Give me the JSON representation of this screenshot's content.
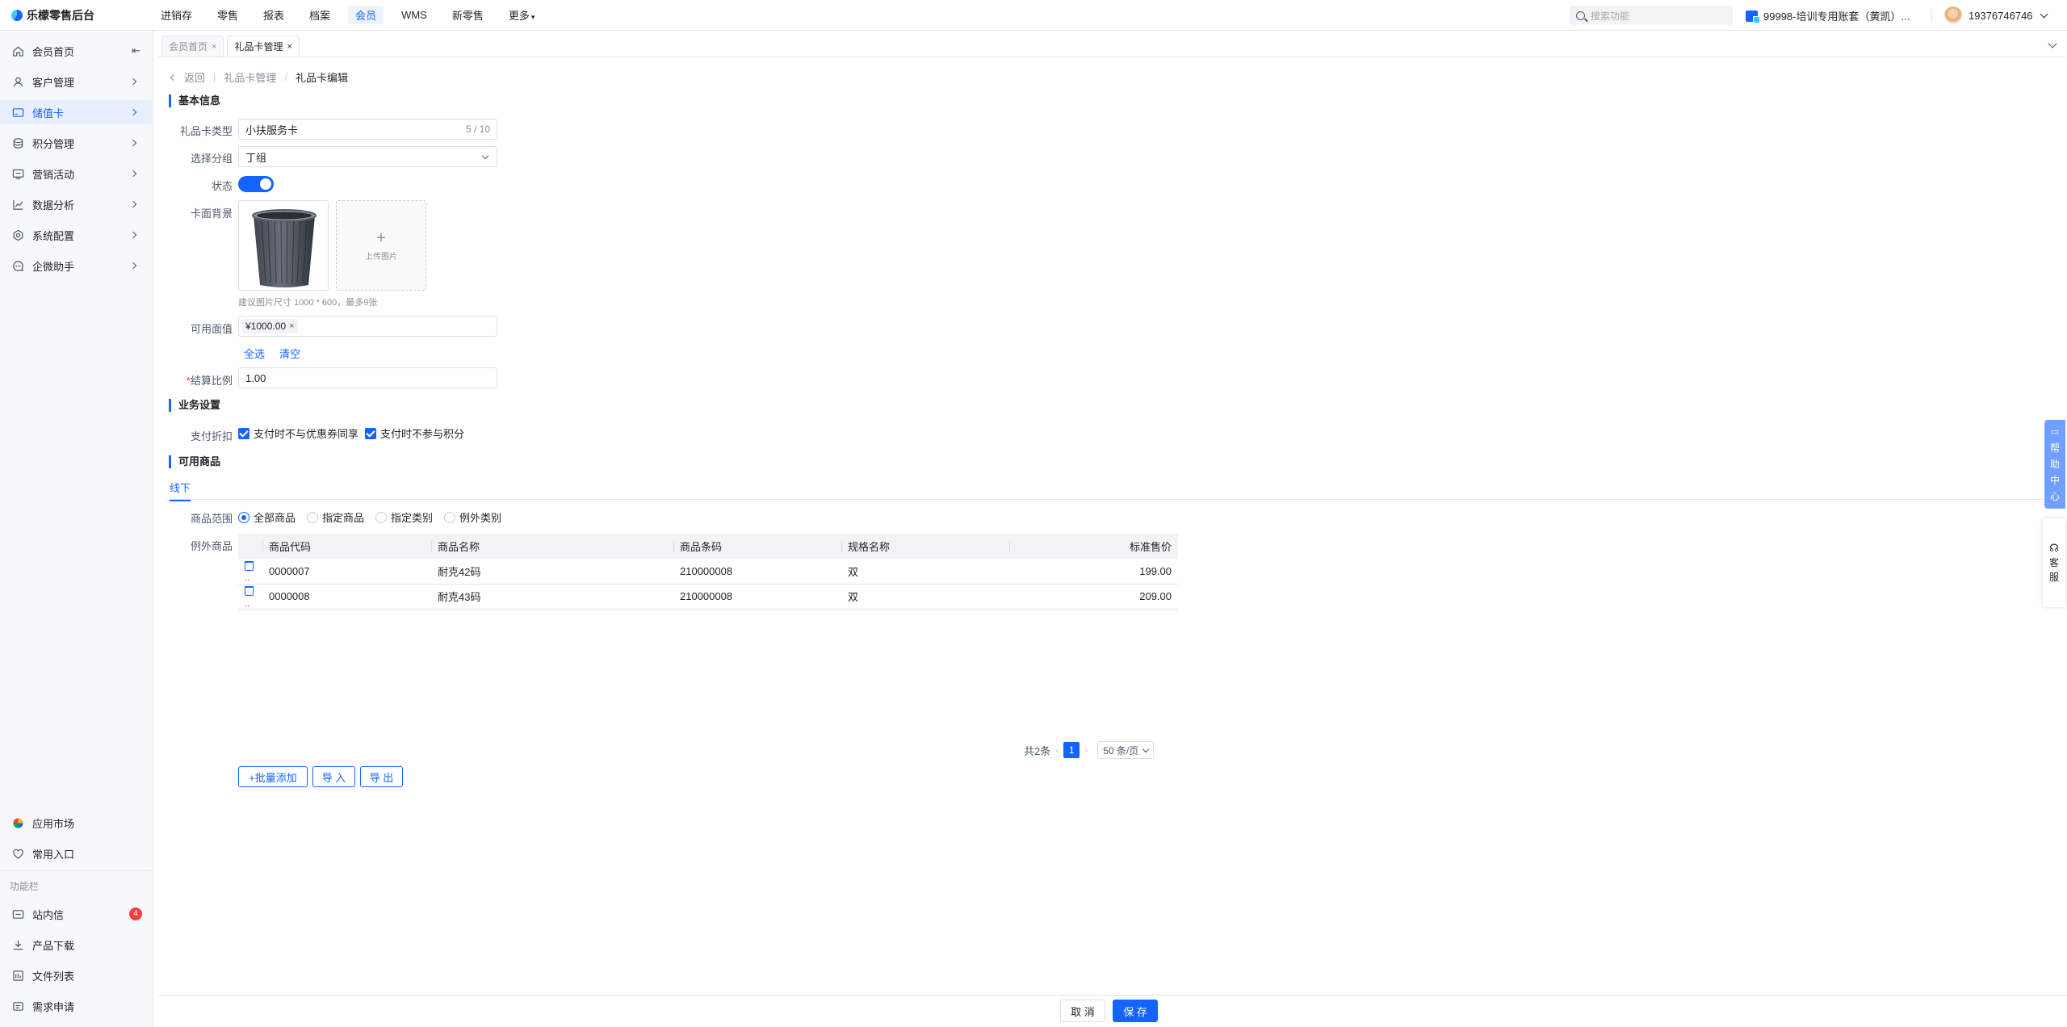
{
  "app": {
    "title": "乐檬零售后台"
  },
  "topnav": [
    "进销存",
    "零售",
    "报表",
    "档案",
    "会员",
    "WMS",
    "新零售",
    "更多"
  ],
  "topnav_active": 4,
  "search": {
    "placeholder": "搜索功能"
  },
  "account": {
    "label": "99998-培训专用账套（黄凯）..."
  },
  "user": {
    "phone": "19376746746"
  },
  "sidebar": {
    "items": [
      {
        "label": "会员首页",
        "icon": "home-icon"
      },
      {
        "label": "客户管理",
        "icon": "user-icon"
      },
      {
        "label": "储值卡",
        "icon": "card-icon"
      },
      {
        "label": "积分管理",
        "icon": "coins-icon"
      },
      {
        "label": "营销活动",
        "icon": "megaphone-icon"
      },
      {
        "label": "数据分析",
        "icon": "chart-icon"
      },
      {
        "label": "系统配置",
        "icon": "settings-icon"
      },
      {
        "label": "企微助手",
        "icon": "chat-icon"
      }
    ],
    "active_index": 2,
    "bottom": [
      {
        "label": "应用市场",
        "icon": "app-market-icon"
      },
      {
        "label": "常用入口",
        "icon": "heart-icon"
      }
    ],
    "group_title": "功能栏",
    "tools": [
      {
        "label": "站内信",
        "icon": "mail-icon",
        "badge": "4"
      },
      {
        "label": "产品下载",
        "icon": "download-icon"
      },
      {
        "label": "文件列表",
        "icon": "file-list-icon"
      },
      {
        "label": "需求申请",
        "icon": "request-icon"
      }
    ]
  },
  "tabs": [
    {
      "label": "会员首页",
      "close": "×"
    },
    {
      "label": "礼品卡管理",
      "close": "×"
    }
  ],
  "breadcrumb": {
    "back": "返回",
    "parent": "礼品卡管理",
    "sep": "/",
    "current": "礼品卡编辑"
  },
  "sections": {
    "basic": "基本信息",
    "business": "业务设置",
    "goods": "可用商品"
  },
  "form": {
    "card_type_label": "礼品卡类型",
    "card_type_value": "小扶服务卡",
    "card_type_count": "5 / 10",
    "group_label": "选择分组",
    "group_value": "丁组",
    "status_label": "状态",
    "bg_label": "卡面背景",
    "upload_label": "上传图片",
    "upload_plus": "+",
    "bg_hint": "建议图片尺寸 1000 * 600，最多9张",
    "face_value_label": "可用面值",
    "face_value_tag": "¥1000.00",
    "face_value_tag_close": "×",
    "select_all": "全选",
    "clear": "清空",
    "ratio_required": "*",
    "ratio_label": "结算比例",
    "ratio_value": "1.00",
    "discount_label": "支付折扣",
    "checkbox1": "支付时不与优惠券同享",
    "checkbox2": "支付时不参与积分"
  },
  "goods": {
    "subtab": "线下",
    "scope_label": "商品范围",
    "scope_options": [
      "全部商品",
      "指定商品",
      "指定类别",
      "例外类别"
    ],
    "scope_selected": 0,
    "except_label": "例外商品",
    "columns": [
      "商品代码",
      "商品名称",
      "商品条码",
      "规格名称",
      "标准售价"
    ],
    "rows": [
      {
        "code": "0000007",
        "name": "耐克42码",
        "barcode": "210000008",
        "spec": "双",
        "price": "199.00"
      },
      {
        "code": "0000008",
        "name": "耐克43码",
        "barcode": "210000008",
        "spec": "双",
        "price": "209.00"
      }
    ],
    "row_action": "..",
    "total": "共2条",
    "page": "1",
    "prev": "‹",
    "next": "›",
    "page_size": "50 条/页",
    "batch_add": "+批量添加",
    "import": "导 入",
    "export": "导 出"
  },
  "footer": {
    "cancel": "取 消",
    "save": "保 存"
  },
  "floating": {
    "help": [
      "帮",
      "助",
      "中",
      "心"
    ],
    "service": [
      "客",
      "服"
    ]
  },
  "colors": {
    "primary": "#1664ff",
    "danger": "#f53f3f"
  }
}
